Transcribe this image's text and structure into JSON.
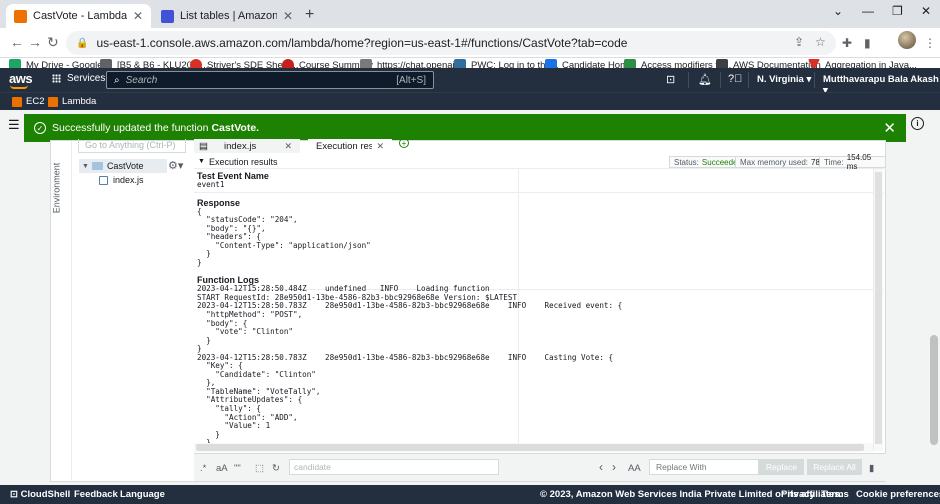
{
  "browser": {
    "tabs": [
      {
        "title": "CastVote - Lambda",
        "color": "#ed7100"
      },
      {
        "title": "List tables | Amazon DynamoDB",
        "color": "#4053d6"
      }
    ],
    "url": "us-east-1.console.aws.amazon.com/lambda/home?region=us-east-1#/functions/CastVote?tab=code",
    "bookmarks": [
      {
        "label": "My Drive - Google...",
        "color": "#1fa463"
      },
      {
        "label": "[B5 & B6 - KLU20-2...",
        "color": "#5f6368"
      },
      {
        "label": "Striver's SDE Sheet...",
        "color": "#d93025"
      },
      {
        "label": "Course Summary",
        "color": "#c5221f"
      },
      {
        "label": "https://chat.openai....",
        "color": "#7a7a7a"
      },
      {
        "label": "PWC: Log in to the...",
        "color": "#2f6f9f"
      },
      {
        "label": "Candidate Home",
        "color": "#1a73e8"
      },
      {
        "label": "Access modifiers fo...",
        "color": "#2f8d46"
      },
      {
        "label": "AWS Documentation",
        "color": "#3c4043"
      },
      {
        "label": "Aggregation in Java...",
        "color": "#d93025"
      }
    ]
  },
  "aws": {
    "logo": "aws",
    "services": "Services",
    "search_placeholder": "Search",
    "search_shortcut": "[Alt+S]",
    "region": "N. Virginia",
    "user": "Mutthavarapu Bala Akash",
    "favorites": [
      "EC2",
      "Lambda"
    ]
  },
  "flash": {
    "message": "Successfully updated the function",
    "function": "CastVote."
  },
  "ide": {
    "environment_label": "Environment",
    "goto_placeholder": "Go to Anything (Ctrl-P)",
    "folder": "CastVote",
    "file": "index.js",
    "tabs": [
      {
        "label": "index.js"
      },
      {
        "label": "Execution result"
      }
    ],
    "results_title": "Execution results",
    "status_label": "Status:",
    "status_value": "Succeeded",
    "memory_label": "Max memory used:",
    "memory_value": "78 MB",
    "time_label": "Time:",
    "time_value": "154.05 ms",
    "test_event_title": "Test Event Name",
    "test_event_name": "event1",
    "response_title": "Response",
    "response_body": "{\n  \"statusCode\": \"204\",\n  \"body\": \"{}\",\n  \"headers\": {\n    \"Content-Type\": \"application/json\"\n  }\n}",
    "logs_title": "Function Logs",
    "logs_body": "2023-04-12T15:28:50.484Z    undefined   INFO    Loading function\nSTART RequestId: 28e950d1-13be-4586-82b3-bbc92968e68e Version: $LATEST\n2023-04-12T15:28:50.783Z    28e950d1-13be-4586-82b3-bbc92968e68e    INFO    Received event: {\n  \"httpMethod\": \"POST\",\n  \"body\": {\n    \"vote\": \"Clinton\"\n  }\n}\n2023-04-12T15:28:50.783Z    28e950d1-13be-4586-82b3-bbc92968e68e    INFO    Casting Vote: {\n  \"Key\": {\n    \"Candidate\": \"Clinton\"\n  },\n  \"TableName\": \"VoteTally\",\n  \"AttributeUpdates\": {\n    \"tally\": {\n      \"Action\": \"ADD\",\n      \"Value\": 1\n    }\n  }\n}",
    "find": {
      "regex": ".*",
      "case": "aA",
      "word": "\"\"",
      "find_value": "candidate",
      "whole_word": "AA",
      "replace_placeholder": "Replace With",
      "replace": "Replace",
      "replace_all": "Replace All"
    }
  },
  "footer": {
    "cloudshell": "CloudShell",
    "feedback": "Feedback",
    "language": "Language",
    "copyright": "© 2023, Amazon Web Services India Private Limited or its affiliates.",
    "privacy": "Privacy",
    "terms": "Terms",
    "cookies": "Cookie preferences"
  }
}
